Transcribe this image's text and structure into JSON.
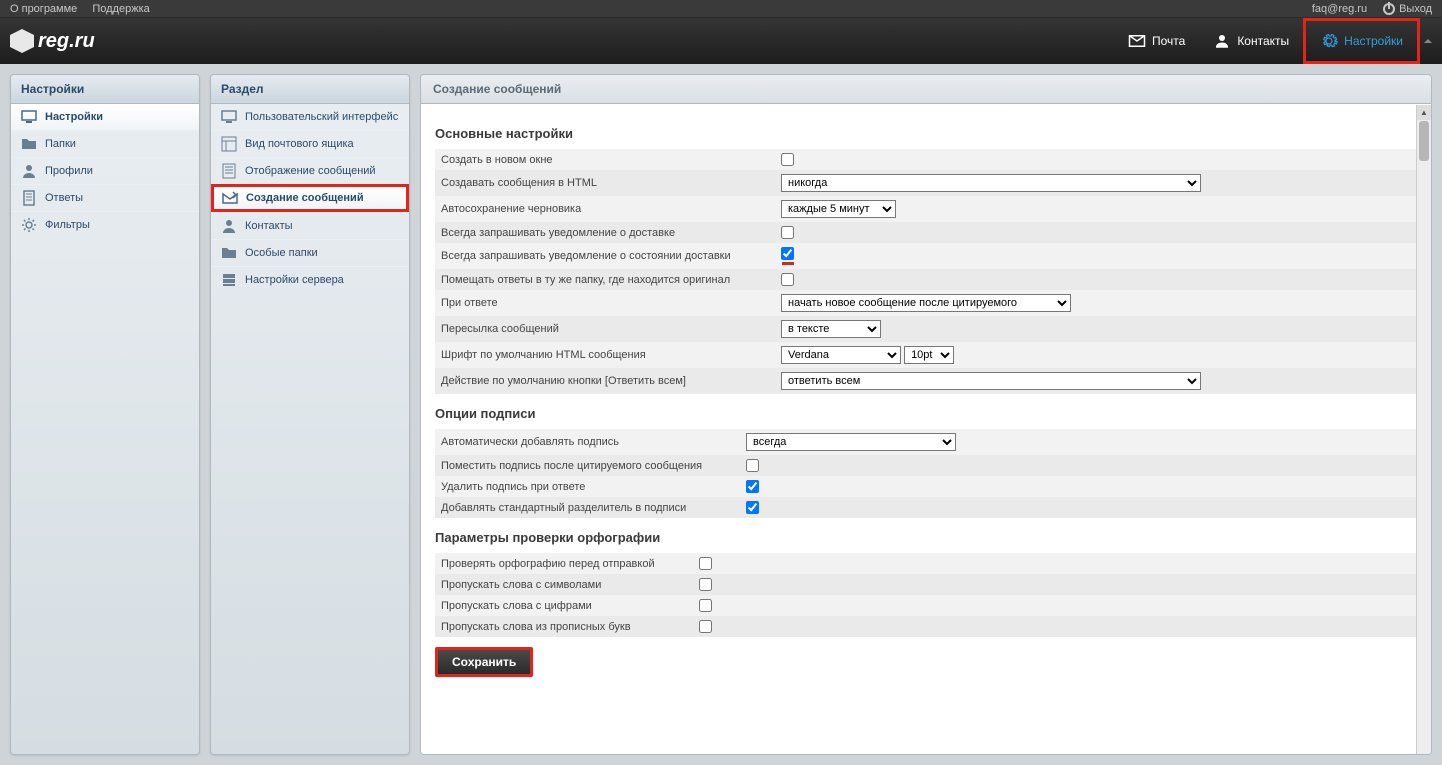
{
  "topbar": {
    "about": "О программе",
    "support": "Поддержка",
    "faq": "faq@reg.ru",
    "logout": "Выход"
  },
  "logo_text": "reg.ru",
  "header_nav": {
    "mail": "Почта",
    "contacts": "Контакты",
    "settings": "Настройки"
  },
  "sidebar1": {
    "title": "Настройки",
    "items": [
      {
        "label": "Настройки",
        "icon": "monitor"
      },
      {
        "label": "Папки",
        "icon": "folder"
      },
      {
        "label": "Профили",
        "icon": "person"
      },
      {
        "label": "Ответы",
        "icon": "sheet"
      },
      {
        "label": "Фильтры",
        "icon": "gear"
      }
    ]
  },
  "sidebar2": {
    "title": "Раздел",
    "items": [
      {
        "label": "Пользовательский интерфейс",
        "icon": "monitor"
      },
      {
        "label": "Вид почтового ящика",
        "icon": "layout"
      },
      {
        "label": "Отображение сообщений",
        "icon": "doc"
      },
      {
        "label": "Создание сообщений",
        "icon": "compose"
      },
      {
        "label": "Контакты",
        "icon": "person"
      },
      {
        "label": "Особые папки",
        "icon": "folder"
      },
      {
        "label": "Настройки сервера",
        "icon": "server"
      }
    ]
  },
  "main": {
    "title": "Создание сообщений",
    "section1_title": "Основные настройки",
    "rows1": {
      "new_window": "Создать в новом окне",
      "html_compose": "Создавать сообщения в HTML",
      "html_compose_sel": "никогда",
      "autosave": "Автосохранение черновика",
      "autosave_sel": "каждые 5 минут",
      "receipt": "Всегда запрашивать уведомление о доставке",
      "dsn": "Всегда запрашивать уведомление о состоянии доставки",
      "same_folder": "Помещать ответы в ту же папку, где находится оригинал",
      "reply_mode": "При ответе",
      "reply_mode_sel": "начать новое сообщение после цитируемого",
      "forward_mode": "Пересылка сообщений",
      "forward_mode_sel": "в тексте",
      "default_font": "Шрифт по умолчанию HTML сообщения",
      "default_font_sel": "Verdana",
      "default_font_size_sel": "10pt",
      "reply_all": "Действие по умолчанию кнопки [Ответить всем]",
      "reply_all_sel": "ответить всем"
    },
    "section2_title": "Опции подписи",
    "rows2": {
      "auto_sig": "Автоматически добавлять подпись",
      "auto_sig_sel": "всегда",
      "sig_below": "Поместить подпись после цитируемого сообщения",
      "sig_remove": "Удалить подпись при ответе",
      "sig_sep": "Добавлять стандартный разделитель в подписи"
    },
    "section3_title": "Параметры проверки орфографии",
    "rows3": {
      "spell_before": "Проверять орфографию перед отправкой",
      "skip_sym": "Пропускать слова с символами",
      "skip_num": "Пропускать слова с цифрами",
      "skip_caps": "Пропускать слова из прописных букв"
    },
    "save_label": "Сохранить"
  }
}
